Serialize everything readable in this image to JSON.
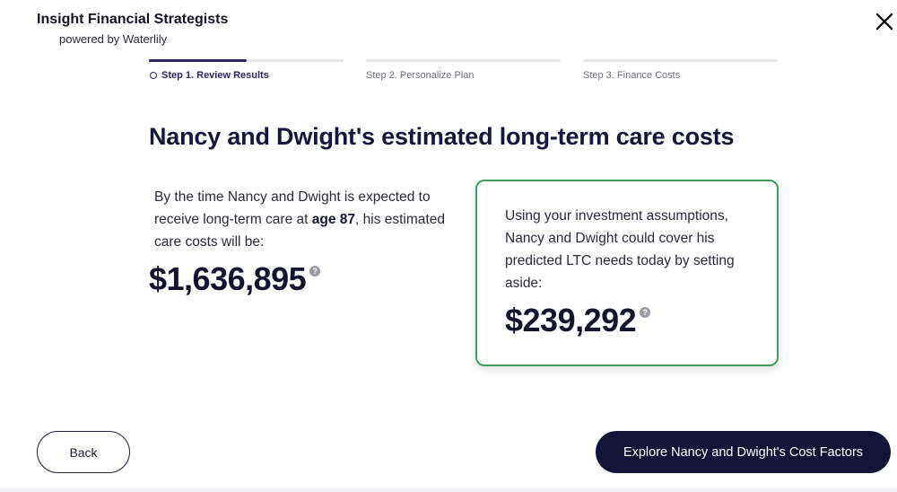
{
  "header": {
    "brand_name": "Insight Financial Strategists",
    "brand_sub": "powered by Waterlily"
  },
  "steps": [
    {
      "label": "Step 1. Review Results",
      "active": true,
      "progress": 0.5
    },
    {
      "label": "Step 2. Personalize Plan",
      "active": false,
      "progress": 0
    },
    {
      "label": "Step 3. Finance Costs",
      "active": false,
      "progress": 0
    }
  ],
  "main": {
    "title": "Nancy and Dwight's estimated long-term care costs",
    "left": {
      "text_before": "By the time Nancy and Dwight is expected to receive long-term care at ",
      "age_text": "age 87",
      "text_after": ", his estimated care costs will be:",
      "amount": "$1,636,895"
    },
    "card": {
      "text": "Using your investment assumptions, Nancy and Dwight could cover his predicted LTC needs today by setting aside:",
      "amount": "$239,292"
    }
  },
  "footer": {
    "back_label": "Back",
    "explore_label": "Explore Nancy and Dwight's Cost Factors"
  },
  "icons": {
    "help": "?",
    "close": "close-icon"
  },
  "colors": {
    "accent": "#2b2466",
    "card_border": "#3aa05a",
    "primary_button": "#14143a"
  }
}
